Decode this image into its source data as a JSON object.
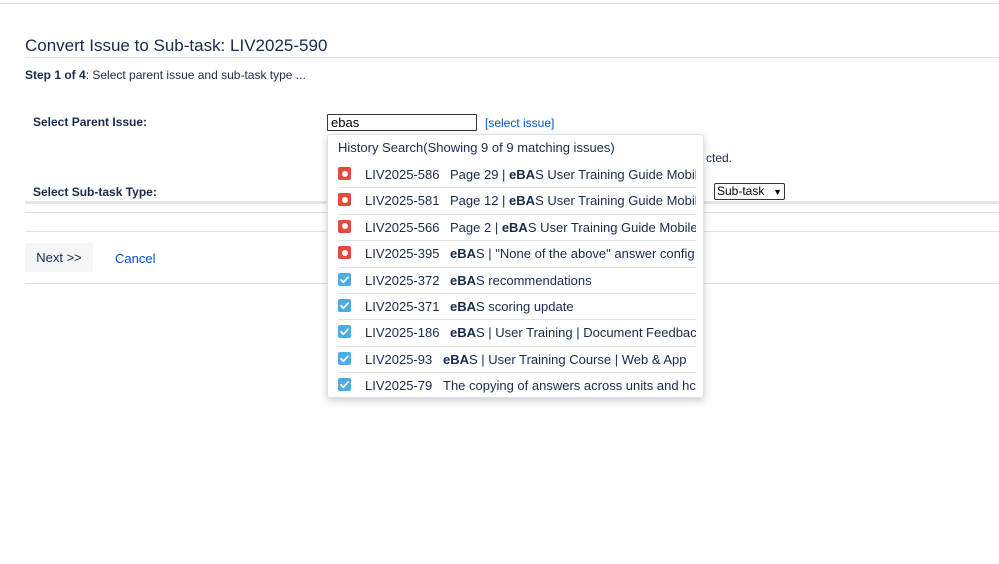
{
  "page": {
    "title": "Convert Issue to Sub-task: LIV2025-590",
    "step_bold": "Step 1 of 4",
    "step_rest": ": Select parent issue and sub-task type ..."
  },
  "form": {
    "parent_label": "Select Parent Issue:",
    "parent_value": "ebas",
    "select_issue_link": "[select issue]",
    "hint_fragment": "cted.",
    "subtask_label": "Select Sub-task Type:",
    "subtask_selected": "Sub-task"
  },
  "actions": {
    "next": "Next >>",
    "cancel": "Cancel"
  },
  "dropdown": {
    "header": "History Search(Showing 9 of 9 matching issues)",
    "items": [
      {
        "key": "LIV2025-586",
        "type": "bug",
        "pre": "Page 29 | ",
        "match": "eBA",
        "post": "S User Training Guide Mobil"
      },
      {
        "key": "LIV2025-581",
        "type": "bug",
        "pre": "Page 12 | ",
        "match": "eBA",
        "post": "S User Training Guide Mobil"
      },
      {
        "key": "LIV2025-566",
        "type": "bug",
        "pre": "Page 2 | ",
        "match": "eBA",
        "post": "S User Training Guide Mobile"
      },
      {
        "key": "LIV2025-395",
        "type": "bug",
        "pre": "",
        "match": "eBA",
        "post": "S | \"None of the above\" answer config"
      },
      {
        "key": "LIV2025-372",
        "type": "task",
        "pre": "",
        "match": "eBA",
        "post": "S recommendations"
      },
      {
        "key": "LIV2025-371",
        "type": "task",
        "pre": "",
        "match": "eBA",
        "post": "S scoring update"
      },
      {
        "key": "LIV2025-186",
        "type": "task",
        "pre": "",
        "match": "eBA",
        "post": "S | User Training | Document Feedbacl"
      },
      {
        "key": "LIV2025-93",
        "type": "task",
        "pre": "",
        "match": "eBA",
        "post": "S | User Training Course | Web & App"
      },
      {
        "key": "LIV2025-79",
        "type": "task",
        "pre": "The copying of answers across units and hc",
        "match": "",
        "post": ""
      }
    ]
  }
}
